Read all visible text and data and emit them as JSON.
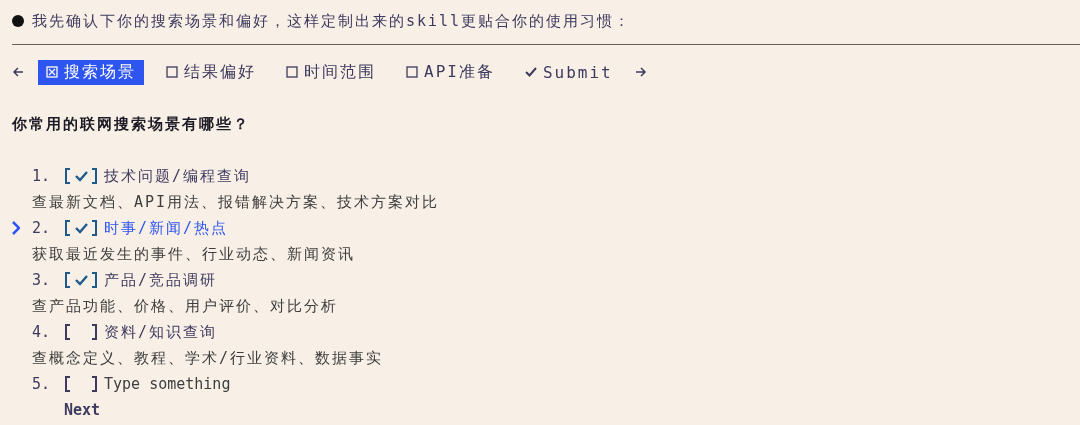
{
  "intro": "我先确认下你的搜索场景和偏好，这样定制出来的skill更贴合你的使用习惯：",
  "tabs": [
    {
      "label": "搜索场景",
      "selected": true
    },
    {
      "label": "结果偏好",
      "selected": false
    },
    {
      "label": "时间范围",
      "selected": false
    },
    {
      "label": "API准备",
      "selected": false
    }
  ],
  "submit": {
    "label": "Submit"
  },
  "question": "你常用的联网搜索场景有哪些？",
  "options": [
    {
      "kind": "choice",
      "number": "1.",
      "checked": true,
      "selected": false,
      "label": "技术问题/编程查询",
      "description": "查最新文档、API用法、报错解决方案、技术方案对比"
    },
    {
      "kind": "choice",
      "number": "2.",
      "checked": true,
      "selected": true,
      "label": "时事/新闻/热点",
      "description": "获取最近发生的事件、行业动态、新闻资讯"
    },
    {
      "kind": "choice",
      "number": "3.",
      "checked": true,
      "selected": false,
      "label": "产品/竞品调研",
      "description": "查产品功能、价格、用户评价、对比分析"
    },
    {
      "kind": "choice",
      "number": "4.",
      "checked": false,
      "selected": false,
      "label": "资料/知识查询",
      "description": "查概念定义、教程、学术/行业资料、数据事实"
    },
    {
      "kind": "input",
      "number": "5.",
      "checked": false,
      "selected": false,
      "placeholder": "Type something"
    }
  ],
  "next": "Next"
}
